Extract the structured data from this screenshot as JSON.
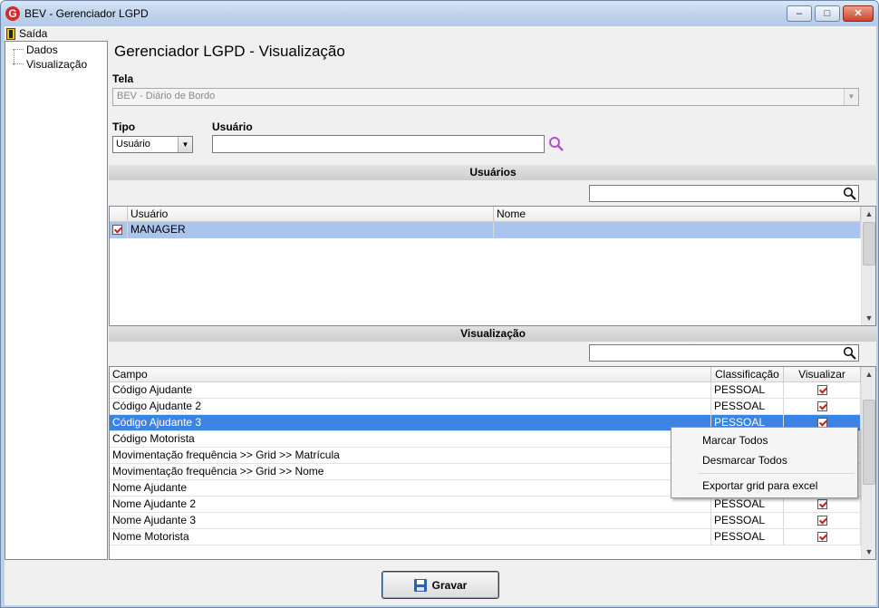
{
  "window": {
    "title": "BEV - Gerenciador LGPD",
    "minimize": "‒",
    "maximize": "□",
    "close": "✕"
  },
  "menu": {
    "exit_label": "Saída"
  },
  "tree": {
    "items": [
      "Dados",
      "Visualização"
    ]
  },
  "page_title": "Gerenciador LGPD - Visualização",
  "tela": {
    "label": "Tela",
    "value": "BEV - Diário de Bordo"
  },
  "tipo": {
    "label": "Tipo",
    "value": "Usuário"
  },
  "usuario": {
    "label": "Usuário",
    "value": ""
  },
  "usuarios_section": {
    "title": "Usuários",
    "filter_value": "",
    "columns": [
      "Usuário",
      "Nome"
    ],
    "rows": [
      {
        "checked": true,
        "usuario": "MANAGER",
        "nome": ""
      }
    ]
  },
  "visualizacao_section": {
    "title": "Visualização",
    "filter_value": "",
    "columns": [
      "Campo",
      "Classificação",
      "Visualizar"
    ],
    "rows": [
      {
        "campo": "Código Ajudante",
        "classificacao": "PESSOAL",
        "visualizar": true
      },
      {
        "campo": "Código Ajudante 2",
        "classificacao": "PESSOAL",
        "visualizar": true
      },
      {
        "campo": "Código Ajudante 3",
        "classificacao": "PESSOAL",
        "visualizar": true
      },
      {
        "campo": "Código Motorista",
        "classificacao": "",
        "visualizar": false
      },
      {
        "campo": "Movimentação frequência >> Grid >> Matrícula",
        "classificacao": "",
        "visualizar": false
      },
      {
        "campo": "Movimentação frequência >> Grid >> Nome",
        "classificacao": "",
        "visualizar": false
      },
      {
        "campo": "Nome Ajudante",
        "classificacao": "",
        "visualizar": false
      },
      {
        "campo": "Nome Ajudante 2",
        "classificacao": "PESSOAL",
        "visualizar": true
      },
      {
        "campo": "Nome Ajudante 3",
        "classificacao": "PESSOAL",
        "visualizar": true
      },
      {
        "campo": "Nome Motorista",
        "classificacao": "PESSOAL",
        "visualizar": true
      }
    ],
    "selected_row": 2
  },
  "context_menu": {
    "items": [
      "Marcar Todos",
      "Desmarcar Todos",
      "Exportar grid para excel"
    ]
  },
  "save_button": {
    "label": "Gravar"
  },
  "colors": {
    "selection": "#3b84e3",
    "checkmark": "#c81e1e",
    "accent_icon": "#b44fd0"
  },
  "icons": [
    "app-logo-icon",
    "exit-door-icon",
    "search-icon",
    "save-disk-icon"
  ]
}
